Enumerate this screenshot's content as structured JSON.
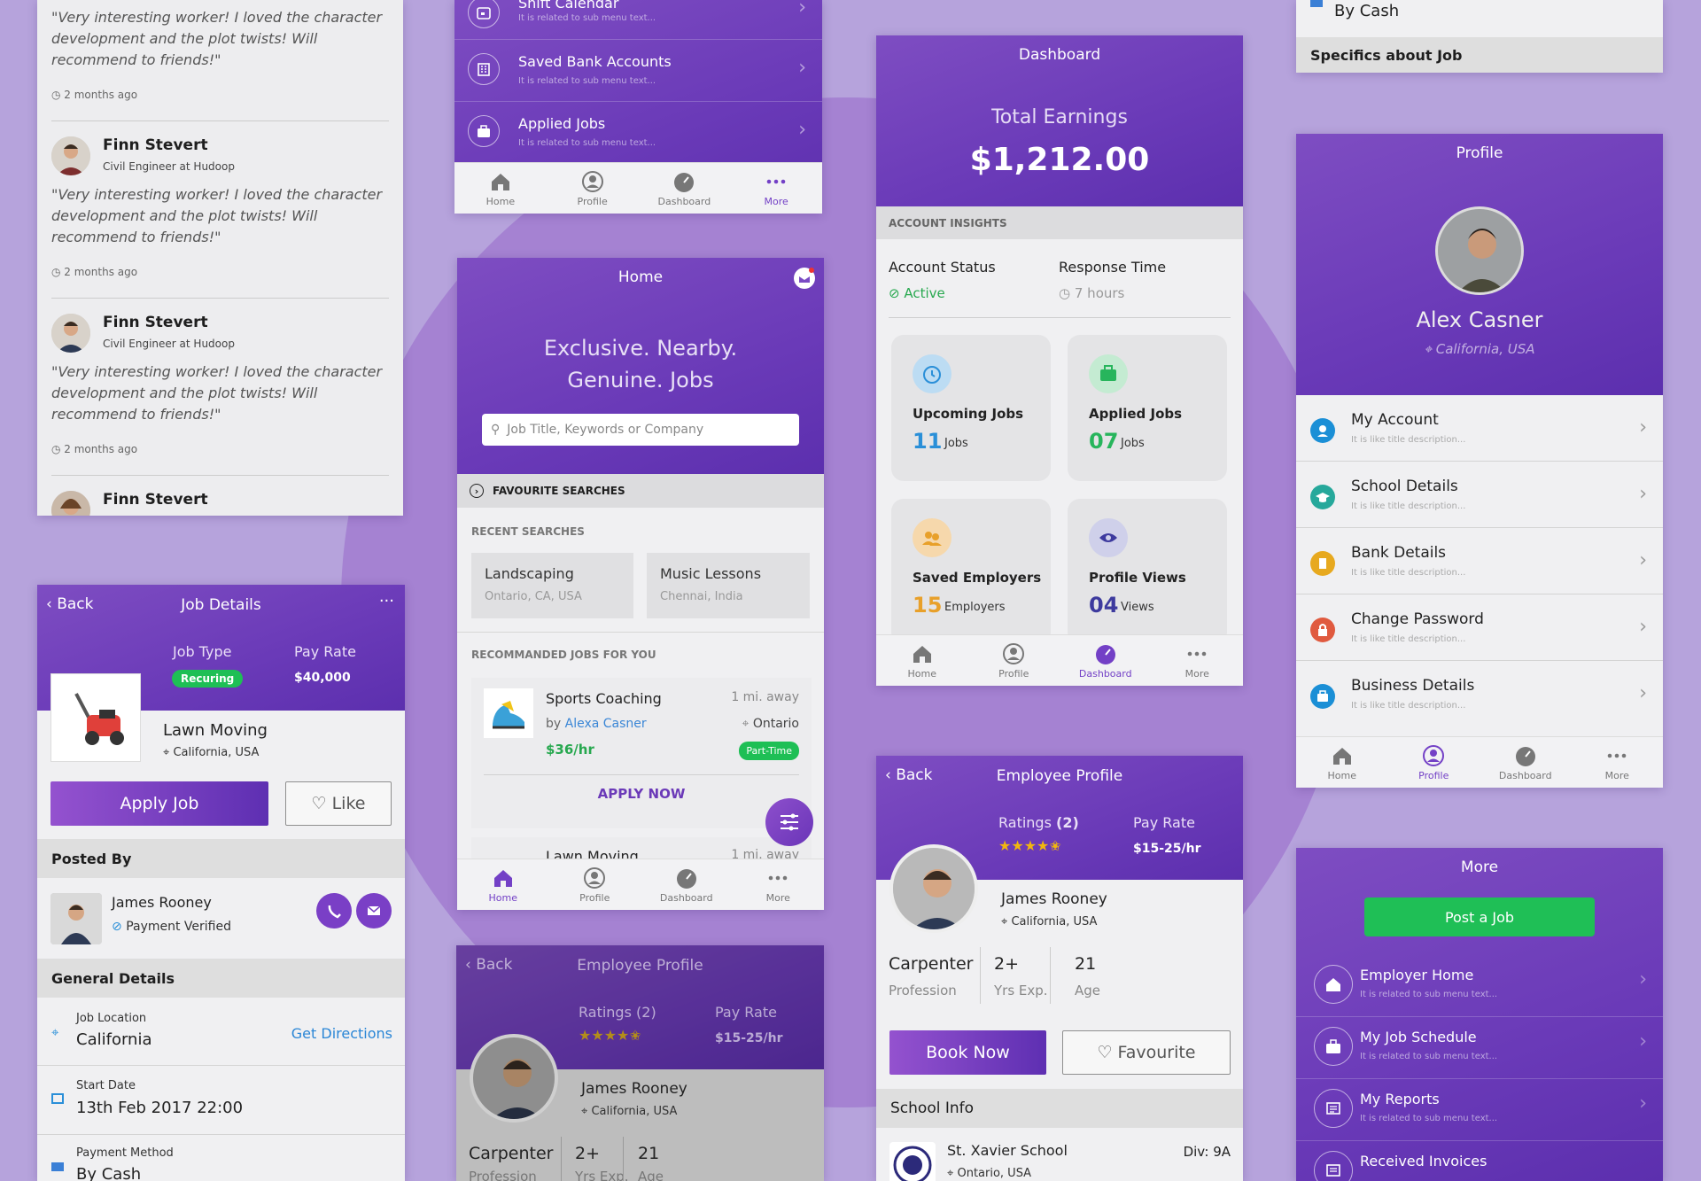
{
  "reviews": {
    "items": [
      {
        "name": "",
        "role": "",
        "text": "\"Very interesting worker! I loved the character development and the plot twists! Will recommend to friends!\"",
        "time": "2 months ago"
      },
      {
        "name": "Finn Stevert",
        "role": "Civil Engineer at Hudoop",
        "text": "\"Very interesting worker! I loved the character development and the plot twists! Will recommend to friends!\"",
        "time": "2 months ago"
      },
      {
        "name": "Finn Stevert",
        "role": "Civil Engineer at Hudoop",
        "text": "\"Very interesting worker! I loved the character development and the plot twists! Will recommend to friends!\"",
        "time": "2 months ago"
      },
      {
        "name": "Finn Stevert"
      }
    ]
  },
  "menu_top": {
    "items": [
      {
        "label": "Shift Calendar",
        "sub": "It is related to sub menu text..."
      },
      {
        "label": "Saved Bank Accounts",
        "sub": "It is related to sub menu text..."
      },
      {
        "label": "Applied Jobs",
        "sub": "It is related to sub menu text..."
      }
    ]
  },
  "tabs": {
    "home": "Home",
    "profile": "Profile",
    "dashboard": "Dashboard",
    "more": "More"
  },
  "home": {
    "title": "Home",
    "tagline": "Exclusive. Nearby. Genuine. Jobs",
    "search_placeholder": "Job Title, Keywords or Company",
    "fav_label": "FAVOURITE SEARCHES",
    "recent_label": "RECENT SEARCHES",
    "recent": [
      {
        "title": "Landscaping",
        "place": "Ontario, CA, USA"
      },
      {
        "title": "Music Lessons",
        "place": "Chennai, India"
      }
    ],
    "recommended_label": "RECOMMANDED JOBS FOR YOU",
    "job": {
      "title": "Sports Coaching",
      "distance": "1 mi. away",
      "by": "by",
      "author": "Alexa Casner",
      "city": "Ontario",
      "rate": "$36/hr",
      "type": "Part-Time",
      "apply": "APPLY NOW"
    },
    "next_job": {
      "title": "Lawn Moving",
      "distance": "1 mi. away"
    }
  },
  "dashboard": {
    "title": "Dashboard",
    "earnings_label": "Total Earnings",
    "earnings": "$1,212.00",
    "insights": "ACCOUNT INSIGHTS",
    "status_label": "Account Status",
    "status": "Active",
    "response_label": "Response Time",
    "response": "7 hours",
    "stats": [
      {
        "label": "Upcoming Jobs",
        "value": "11",
        "unit": "Jobs",
        "color": "#2a8fd8"
      },
      {
        "label": "Applied Jobs",
        "value": "07",
        "unit": "Jobs",
        "color": "#27b55c"
      },
      {
        "label": "Saved Employers",
        "value": "15",
        "unit": "Employers",
        "color": "#e8a02a"
      },
      {
        "label": "Profile Views",
        "value": "04",
        "unit": "Views",
        "color": "#3d3a9e"
      }
    ]
  },
  "payment_top": {
    "value": "By Cash",
    "section": "Specifics about Job"
  },
  "profile": {
    "title": "Profile",
    "name": "Alex Casner",
    "location": "California, USA",
    "items": [
      {
        "label": "My Account",
        "sub": "It is like title description...",
        "color": "#1b8fd6"
      },
      {
        "label": "School Details",
        "sub": "It is like title description...",
        "color": "#26a89b"
      },
      {
        "label": "Bank Details",
        "sub": "It is like title description...",
        "color": "#e7a91f"
      },
      {
        "label": "Change Password",
        "sub": "It is like title description...",
        "color": "#e05a3f"
      },
      {
        "label": "Business Details",
        "sub": "It is like title description...",
        "color": "#1b8fd6"
      }
    ]
  },
  "job_details": {
    "back": "Back",
    "title": "Job Details",
    "more": "···",
    "type_label": "Job Type",
    "type": "Recuring",
    "rate_label": "Pay Rate",
    "rate": "$40,000",
    "job_name": "Lawn Moving",
    "location": "California, USA",
    "apply": "Apply Job",
    "like": "Like",
    "posted_by": "Posted By",
    "poster": "James Rooney",
    "verified": "Payment Verified",
    "general": "General Details",
    "loc_label": "Job Location",
    "loc_value": "California",
    "directions": "Get Directions",
    "start_label": "Start Date",
    "start_value": "13th Feb 2017 22:00",
    "pay_label": "Payment Method",
    "pay_value": "By Cash"
  },
  "employee_profile": {
    "back": "Back",
    "title": "Employee Profile",
    "ratings_label": "Ratings",
    "ratings_count": "(2)",
    "rating_value": 4.5,
    "rate_label": "Pay Rate",
    "rate": "$15-25/hr",
    "name": "James Rooney",
    "location": "California, USA",
    "profession": "Carpenter",
    "profession_label": "Profession",
    "exp": "2+",
    "exp_label": "Yrs Exp.",
    "age": "21",
    "age_label": "Age",
    "book": "Book Now",
    "fav": "Favourite",
    "school_info": "School Info",
    "school": "St. Xavier School",
    "school_loc": "Ontario, USA",
    "div": "Div: 9A"
  },
  "employee_profile2": {
    "back": "Back",
    "title": "Employee Profile",
    "ratings_label": "Ratings",
    "ratings_count": "(2)",
    "rate_label": "Pay Rate",
    "rate": "$15-25/hr",
    "name": "James Rooney",
    "location": "California, USA",
    "profession": "Carpenter",
    "exp": "2+",
    "age": "21",
    "profession_label": "Profession",
    "exp_label": "Yrs Exp.",
    "age_label": "Age"
  },
  "more": {
    "title": "More",
    "post": "Post a Job",
    "items": [
      {
        "label": "Employer Home",
        "sub": "It is related to sub menu text..."
      },
      {
        "label": "My Job Schedule",
        "sub": "It is related to sub menu text..."
      },
      {
        "label": "My Reports",
        "sub": "It is related to sub menu text..."
      },
      {
        "label": "Received Invoices",
        "sub": ""
      }
    ]
  }
}
